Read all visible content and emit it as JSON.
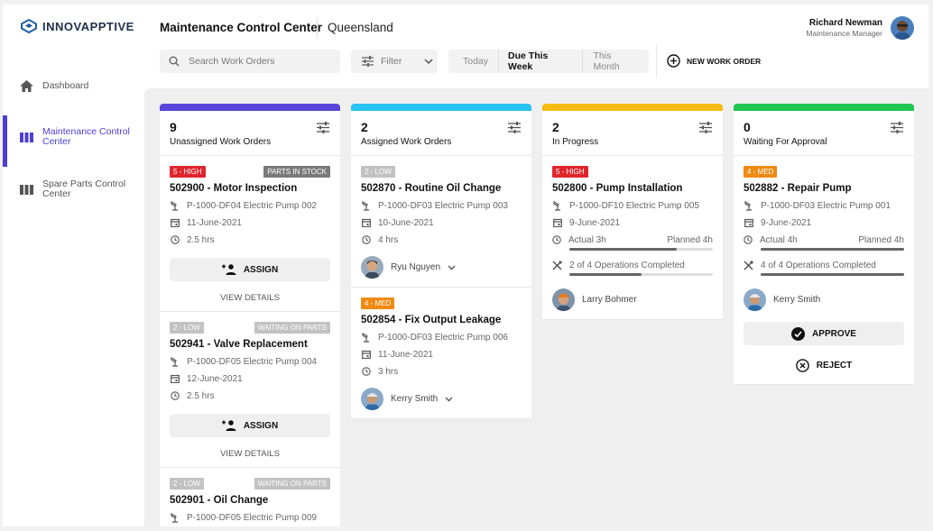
{
  "brand": {
    "name": "INNOVAPPTIVE"
  },
  "sidebar": {
    "items": [
      {
        "label": "Dashboard"
      },
      {
        "label": "Maintenance Control Center"
      },
      {
        "label": "Spare Parts Control Center"
      }
    ]
  },
  "header": {
    "title": "Maintenance Control Center",
    "region": "Queensland",
    "user_name": "Richard Newman",
    "user_role": "Maintenance Manager"
  },
  "toolbar": {
    "search_placeholder": "Search Work Orders",
    "filter_label": "Filter",
    "time_filters": [
      "Today",
      "Due This Week",
      "This Month"
    ],
    "time_filter_selected": "Due This Week",
    "new_work_order": "NEW WORK ORDER"
  },
  "colors": {
    "unassigned": "#5a44d8",
    "assigned": "#27c3f2",
    "in_progress": "#f5bd12",
    "waiting": "#1fc654",
    "high": "#e0262d",
    "med": "#f08a12",
    "low": "#c2c2c2",
    "parts_in_stock": "#7a7a7a",
    "waiting_on_parts": "#c2c2c2",
    "accent": "#4b3fd6"
  },
  "columns": [
    {
      "count": "9",
      "title": "Unassigned Work Orders",
      "cards": [
        {
          "priority": "5 - HIGH",
          "status": "PARTS IN STOCK",
          "title": "502900 - Motor Inspection",
          "equipment": "P-1000-DF04 Electric Pump 002",
          "date": "11-June-2021",
          "duration": "2.5 hrs",
          "assign": "ASSIGN",
          "details": "VIEW DETAILS"
        },
        {
          "priority": "2 - LOW",
          "status": "WAITING ON PARTS",
          "title": "502941 - Valve Replacement",
          "equipment": "P-1000-DF05 Electric Pump 004",
          "date": "12-June-2021",
          "duration": "2.5 hrs",
          "assign": "ASSIGN",
          "details": "VIEW DETAILS"
        },
        {
          "priority": "2 - LOW",
          "status": "WAITING ON PARTS",
          "title": "502901 - Oil Change",
          "equipment": "P-1000-DF05 Electric Pump 009"
        }
      ]
    },
    {
      "count": "2",
      "title": "Assigned Work Orders",
      "cards": [
        {
          "priority": "2 - LOW",
          "title": "502870 - Routine Oil Change",
          "equipment": "P-1000-DF03 Electric Pump 003",
          "date": "10-June-2021",
          "duration": "4 hrs",
          "assignee": "Ryu Nguyen"
        },
        {
          "priority": "4 - MED",
          "title": "502854 - Fix Output Leakage",
          "equipment": "P-1000-DF03 Electric Pump 006",
          "date": "11-June-2021",
          "duration": "3 hrs",
          "assignee": "Kerry Smith"
        }
      ]
    },
    {
      "count": "2",
      "title": "In Progress",
      "cards": [
        {
          "priority": "5 - HIGH",
          "title": "502800 - Pump Installation",
          "equipment": "P-1000-DF10 Electric Pump 005",
          "date": "9-June-2021",
          "actual": "Actual 3h",
          "planned": "Planned 4h",
          "hours_fraction": 0.75,
          "operations": "2 of 4 Operations Completed",
          "ops_fraction": 0.5,
          "assignee": "Larry Bohmer"
        }
      ]
    },
    {
      "count": "0",
      "title": "Waiting For Approval",
      "cards": [
        {
          "priority": "4 - MED",
          "title": "502882 - Repair Pump",
          "equipment": "P-1000-DF03 Electric Pump 001",
          "date": "9-June-2021",
          "actual": "Actual 4h",
          "planned": "Planned 4h",
          "hours_fraction": 1.0,
          "operations": "4 of 4 Operations Completed",
          "ops_fraction": 1.0,
          "assignee": "Kerry Smith",
          "approve": "APPROVE",
          "reject": "REJECT"
        }
      ]
    }
  ]
}
